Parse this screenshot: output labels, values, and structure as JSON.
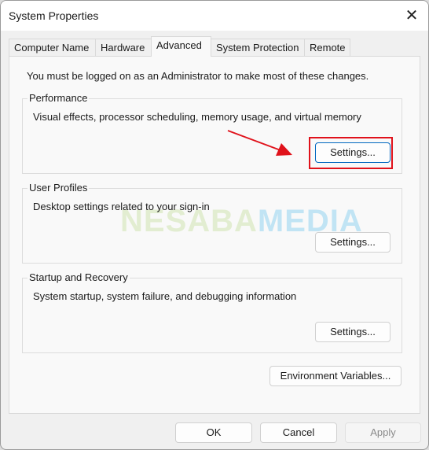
{
  "window": {
    "title": "System Properties",
    "close_icon": "close-icon"
  },
  "tabs": [
    {
      "label": "Computer Name"
    },
    {
      "label": "Hardware"
    },
    {
      "label": "Advanced",
      "active": true
    },
    {
      "label": "System Protection"
    },
    {
      "label": "Remote"
    }
  ],
  "notice": "You must be logged on as an Administrator to make most of these changes.",
  "groups": [
    {
      "title": "Performance",
      "description": "Visual effects, processor scheduling, memory usage, and virtual memory",
      "button": "Settings..."
    },
    {
      "title": "User Profiles",
      "description": "Desktop settings related to your sign-in",
      "button": "Settings..."
    },
    {
      "title": "Startup and Recovery",
      "description": "System startup, system failure, and debugging information",
      "button": "Settings..."
    }
  ],
  "env_button": "Environment Variables...",
  "footer": {
    "ok": "OK",
    "cancel": "Cancel",
    "apply": "Apply"
  },
  "watermark": {
    "part1": "NESABA",
    "part2": "MEDIA"
  },
  "colors": {
    "annotation": "#e0121b",
    "focus": "#0067c0"
  }
}
